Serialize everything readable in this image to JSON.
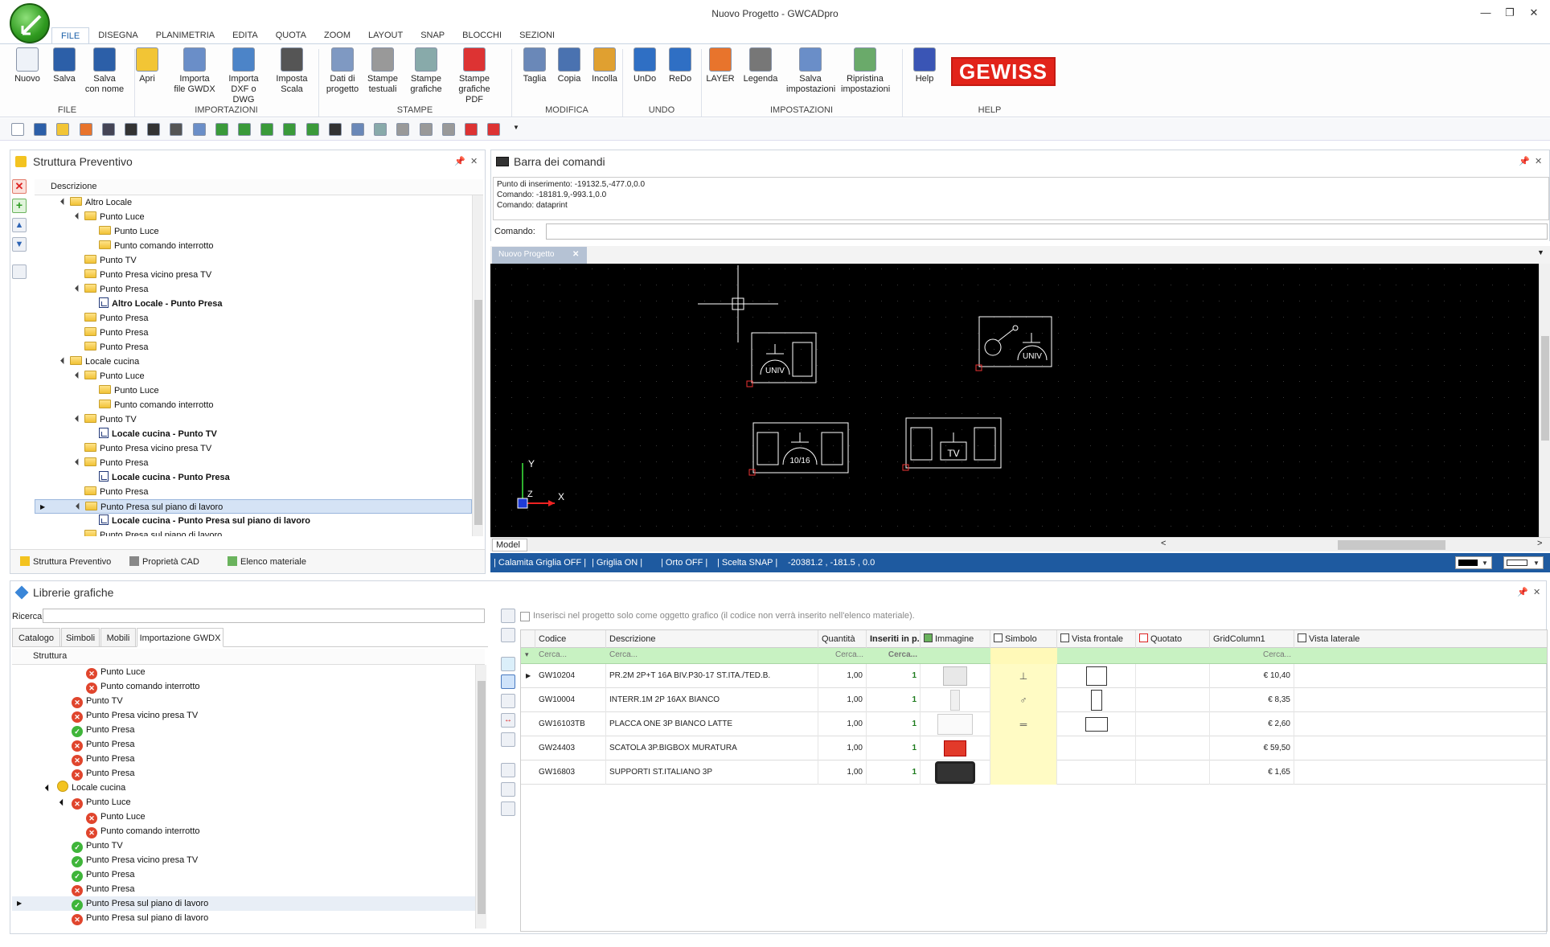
{
  "window": {
    "title": "Nuovo Progetto - GWCADpro"
  },
  "menu": [
    "FILE",
    "DISEGNA",
    "PLANIMETRIA",
    "EDITA",
    "QUOTA",
    "ZOOM",
    "LAYOUT",
    "SNAP",
    "BLOCCHI",
    "SEZIONI"
  ],
  "ribbon": {
    "buttons": [
      {
        "l1": "Nuovo",
        "l2": ""
      },
      {
        "l1": "Salva",
        "l2": ""
      },
      {
        "l1": "Salva",
        "l2": "con nome"
      },
      {
        "l1": "Apri",
        "l2": ""
      },
      {
        "l1": "Importa",
        "l2": "file GWDX"
      },
      {
        "l1": "Importa",
        "l2": "DXF o DWG"
      },
      {
        "l1": "Imposta",
        "l2": "Scala"
      },
      {
        "l1": "Dati di",
        "l2": "progetto"
      },
      {
        "l1": "Stampe",
        "l2": "testuali"
      },
      {
        "l1": "Stampe",
        "l2": "grafiche"
      },
      {
        "l1": "Stampe",
        "l2": "grafiche PDF"
      },
      {
        "l1": "Taglia",
        "l2": ""
      },
      {
        "l1": "Copia",
        "l2": ""
      },
      {
        "l1": "Incolla",
        "l2": ""
      },
      {
        "l1": "UnDo",
        "l2": ""
      },
      {
        "l1": "ReDo",
        "l2": ""
      },
      {
        "l1": "LAYER",
        "l2": ""
      },
      {
        "l1": "Legenda",
        "l2": ""
      },
      {
        "l1": "Salva",
        "l2": "impostazioni"
      },
      {
        "l1": "Ripristina",
        "l2": "impostazioni"
      },
      {
        "l1": "Help",
        "l2": ""
      }
    ],
    "groups": [
      "FILE",
      "IMPORTAZIONI",
      "STAMPE",
      "MODIFICA",
      "UNDO",
      "IMPOSTAZIONI",
      "HELP"
    ],
    "brand": "GEWISS",
    "brand_color": "#e2231a"
  },
  "structure": {
    "title": "Struttura Preventivo",
    "column": "Descrizione",
    "rows": [
      {
        "t": "Altro Locale",
        "lvl": 0,
        "ic": "folder",
        "exp": "▲",
        "b": false
      },
      {
        "t": "Punto Luce",
        "lvl": 1,
        "ic": "folder",
        "exp": "▲",
        "b": false
      },
      {
        "t": "Punto Luce",
        "lvl": 2,
        "ic": "folder",
        "exp": "",
        "b": false
      },
      {
        "t": "Punto comando interrotto",
        "lvl": 2,
        "ic": "folder",
        "exp": "",
        "b": false
      },
      {
        "t": "Punto TV",
        "lvl": 1,
        "ic": "folder",
        "exp": "",
        "b": false
      },
      {
        "t": "Punto Presa vicino presa TV",
        "lvl": 1,
        "ic": "folder",
        "exp": "",
        "b": false
      },
      {
        "t": "Punto Presa",
        "lvl": 1,
        "ic": "folder",
        "exp": "▲",
        "b": false
      },
      {
        "t": "Altro Locale - Punto Presa",
        "lvl": 2,
        "ic": "doc",
        "exp": "",
        "b": true
      },
      {
        "t": "Punto Presa",
        "lvl": 1,
        "ic": "folder",
        "exp": "",
        "b": false
      },
      {
        "t": "Punto Presa",
        "lvl": 1,
        "ic": "folder",
        "exp": "",
        "b": false
      },
      {
        "t": "Punto Presa",
        "lvl": 1,
        "ic": "folder",
        "exp": "",
        "b": false
      },
      {
        "t": "Locale cucina",
        "lvl": 0,
        "ic": "folder",
        "exp": "▲",
        "b": false
      },
      {
        "t": "Punto Luce",
        "lvl": 1,
        "ic": "folder",
        "exp": "▲",
        "b": false
      },
      {
        "t": "Punto Luce",
        "lvl": 2,
        "ic": "folder",
        "exp": "",
        "b": false
      },
      {
        "t": "Punto comando interrotto",
        "lvl": 2,
        "ic": "folder",
        "exp": "",
        "b": false
      },
      {
        "t": "Punto TV",
        "lvl": 1,
        "ic": "folder",
        "exp": "▲",
        "b": false
      },
      {
        "t": "Locale cucina - Punto TV",
        "lvl": 2,
        "ic": "doc",
        "exp": "",
        "b": true
      },
      {
        "t": "Punto Presa vicino presa TV",
        "lvl": 1,
        "ic": "folder",
        "exp": "",
        "b": false
      },
      {
        "t": "Punto Presa",
        "lvl": 1,
        "ic": "folder",
        "exp": "▲",
        "b": false
      },
      {
        "t": "Locale cucina - Punto Presa",
        "lvl": 2,
        "ic": "doc",
        "exp": "",
        "b": true
      },
      {
        "t": "Punto Presa",
        "lvl": 1,
        "ic": "folder",
        "exp": "",
        "b": false
      },
      {
        "t": "Punto Presa sul piano di lavoro",
        "lvl": 1,
        "ic": "folder",
        "exp": "▲",
        "b": false,
        "sel": true
      },
      {
        "t": "Locale cucina - Punto Presa sul piano di lavoro",
        "lvl": 2,
        "ic": "doc",
        "exp": "",
        "b": true
      },
      {
        "t": "Punto Presa sul piano di lavoro",
        "lvl": 1,
        "ic": "folder",
        "exp": "",
        "b": false
      }
    ],
    "tabs": [
      "Struttura Preventivo",
      "Proprietà CAD",
      "Elenco materiale"
    ]
  },
  "commands": {
    "title": "Barra dei comandi",
    "lines": [
      "Punto di inserimento: -19132.5,-477.0,0.0",
      "Comando: -18181.9,-993.1,0.0",
      "Comando: dataprint"
    ],
    "prompt_label": "Comando:",
    "doc_tab": "Nuovo Progetto"
  },
  "canvas": {
    "symbols": [
      "UNIV",
      "UNIV",
      "10/16",
      "TV"
    ],
    "axis_y": "Y",
    "axis_x": "X",
    "axis_z": "Z",
    "model_tab": "Model"
  },
  "status": {
    "items": [
      "| Calamita Griglia OFF |",
      "| Griglia ON |",
      "| Orto OFF |",
      "| Scelta SNAP |"
    ],
    "coords": "-20381.2 , -181.5 , 0.0"
  },
  "library": {
    "title": "Librerie grafiche",
    "search_label": "Ricerca",
    "tabs": [
      "Catalogo",
      "Simboli",
      "Mobili",
      "Importazione GWDX"
    ],
    "column": "Struttura",
    "rows": [
      {
        "t": "Punto Luce",
        "lvl": 2,
        "st": "x"
      },
      {
        "t": "Punto comando interrotto",
        "lvl": 2,
        "st": "x"
      },
      {
        "t": "Punto TV",
        "lvl": 1,
        "st": "x"
      },
      {
        "t": "Punto Presa vicino presa TV",
        "lvl": 1,
        "st": "x"
      },
      {
        "t": "Punto Presa",
        "lvl": 1,
        "st": "ok"
      },
      {
        "t": "Punto Presa",
        "lvl": 1,
        "st": "x"
      },
      {
        "t": "Punto Presa",
        "lvl": 1,
        "st": "x"
      },
      {
        "t": "Punto Presa",
        "lvl": 1,
        "st": "x"
      },
      {
        "t": "Locale cucina",
        "lvl": 0,
        "st": "y"
      },
      {
        "t": "Punto Luce",
        "lvl": 1,
        "st": "x"
      },
      {
        "t": "Punto Luce",
        "lvl": 2,
        "st": "x"
      },
      {
        "t": "Punto comando interrotto",
        "lvl": 2,
        "st": "x"
      },
      {
        "t": "Punto TV",
        "lvl": 1,
        "st": "ok"
      },
      {
        "t": "Punto Presa vicino presa TV",
        "lvl": 1,
        "st": "ok"
      },
      {
        "t": "Punto Presa",
        "lvl": 1,
        "st": "ok"
      },
      {
        "t": "Punto Presa",
        "lvl": 1,
        "st": "x"
      },
      {
        "t": "Punto Presa sul piano di lavoro",
        "lvl": 1,
        "st": "ok",
        "sel": true
      },
      {
        "t": "Punto Presa sul piano di lavoro",
        "lvl": 1,
        "st": "x"
      }
    ]
  },
  "grid": {
    "checkbox_label": "Inserisci nel progetto solo come oggetto grafico (il codice non verrà inserito nell'elenco materiale).",
    "headers": [
      "Codice",
      "Descrizione",
      "Quantità",
      "Inseriti in p...",
      "Immagine",
      "Simbolo",
      "Vista frontale",
      "Quotato",
      "GridColumn1",
      "Vista laterale"
    ],
    "filter": "Cerca...",
    "rows": [
      {
        "code": "GW10204",
        "desc": "PR.2M 2P+T 16A BIV.P30-17 ST.ITA./TED.B.",
        "qty": "1,00",
        "ins": "1",
        "price": "€ 10,40"
      },
      {
        "code": "GW10004",
        "desc": "INTERR.1M 2P 16AX BIANCO",
        "qty": "1,00",
        "ins": "1",
        "price": "€ 8,35"
      },
      {
        "code": "GW16103TB",
        "desc": "PLACCA ONE 3P BIANCO LATTE",
        "qty": "1,00",
        "ins": "1",
        "price": "€ 2,60"
      },
      {
        "code": "GW24403",
        "desc": "SCATOLA 3P.BIGBOX MURATURA",
        "qty": "1,00",
        "ins": "1",
        "price": "€ 59,50"
      },
      {
        "code": "GW16803",
        "desc": "SUPPORTI ST.ITALIANO 3P",
        "qty": "1,00",
        "ins": "1",
        "price": "€ 1,65"
      }
    ]
  }
}
